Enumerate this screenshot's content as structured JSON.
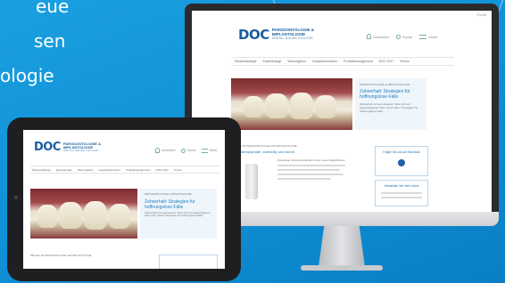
{
  "headline": [
    "eue",
    "sen",
    "ologie"
  ],
  "website": {
    "logo_mark": "DOC",
    "logo_title_1": "PARODONTOLOGIE &",
    "logo_title_2": "IMPLANTOLOGIE",
    "logo_subtitle": "DENTAL ONLINE COLLEGE",
    "top_right_label": "Portal",
    "util": {
      "login": "Anmelden",
      "search": "Suche",
      "menu": "Menü"
    },
    "nav": [
      "Wissensdialoge",
      "Expertentage",
      "Wertungsbox",
      "Gesprächsnotizen",
      "Produktmanagement",
      "DOC 2017",
      "Termin"
    ],
    "hero": {
      "kicker": "PARODONTOLOGIE & IMPLANTOLOGIE",
      "title": "Zahnerhalt: Strategien für hoffnungslose Fälle",
      "teaser": "Zahnerhalt ist heute bekannt: lässt sich ein angeschlagener Zahn noch retten? Strategien für hoffnungslose Fälle."
    },
    "article": {
      "kicker": "BEITRAG IM PARODONTOLOGIE UND IMPLANTOLOGIE",
      "title": "Keramikimplantate: zweiteilig und sicher",
      "body": "Zweiteilige Keramikimplantate bieten neue Möglichkeiten."
    },
    "side_box_1": "Folgen Sie uns auf Facebook",
    "side_box_2": "Newsletter: Nie mehr nichts"
  },
  "colors": {
    "background": "#1198da",
    "brand": "#1b5e9e",
    "link": "#1f7fc0"
  }
}
